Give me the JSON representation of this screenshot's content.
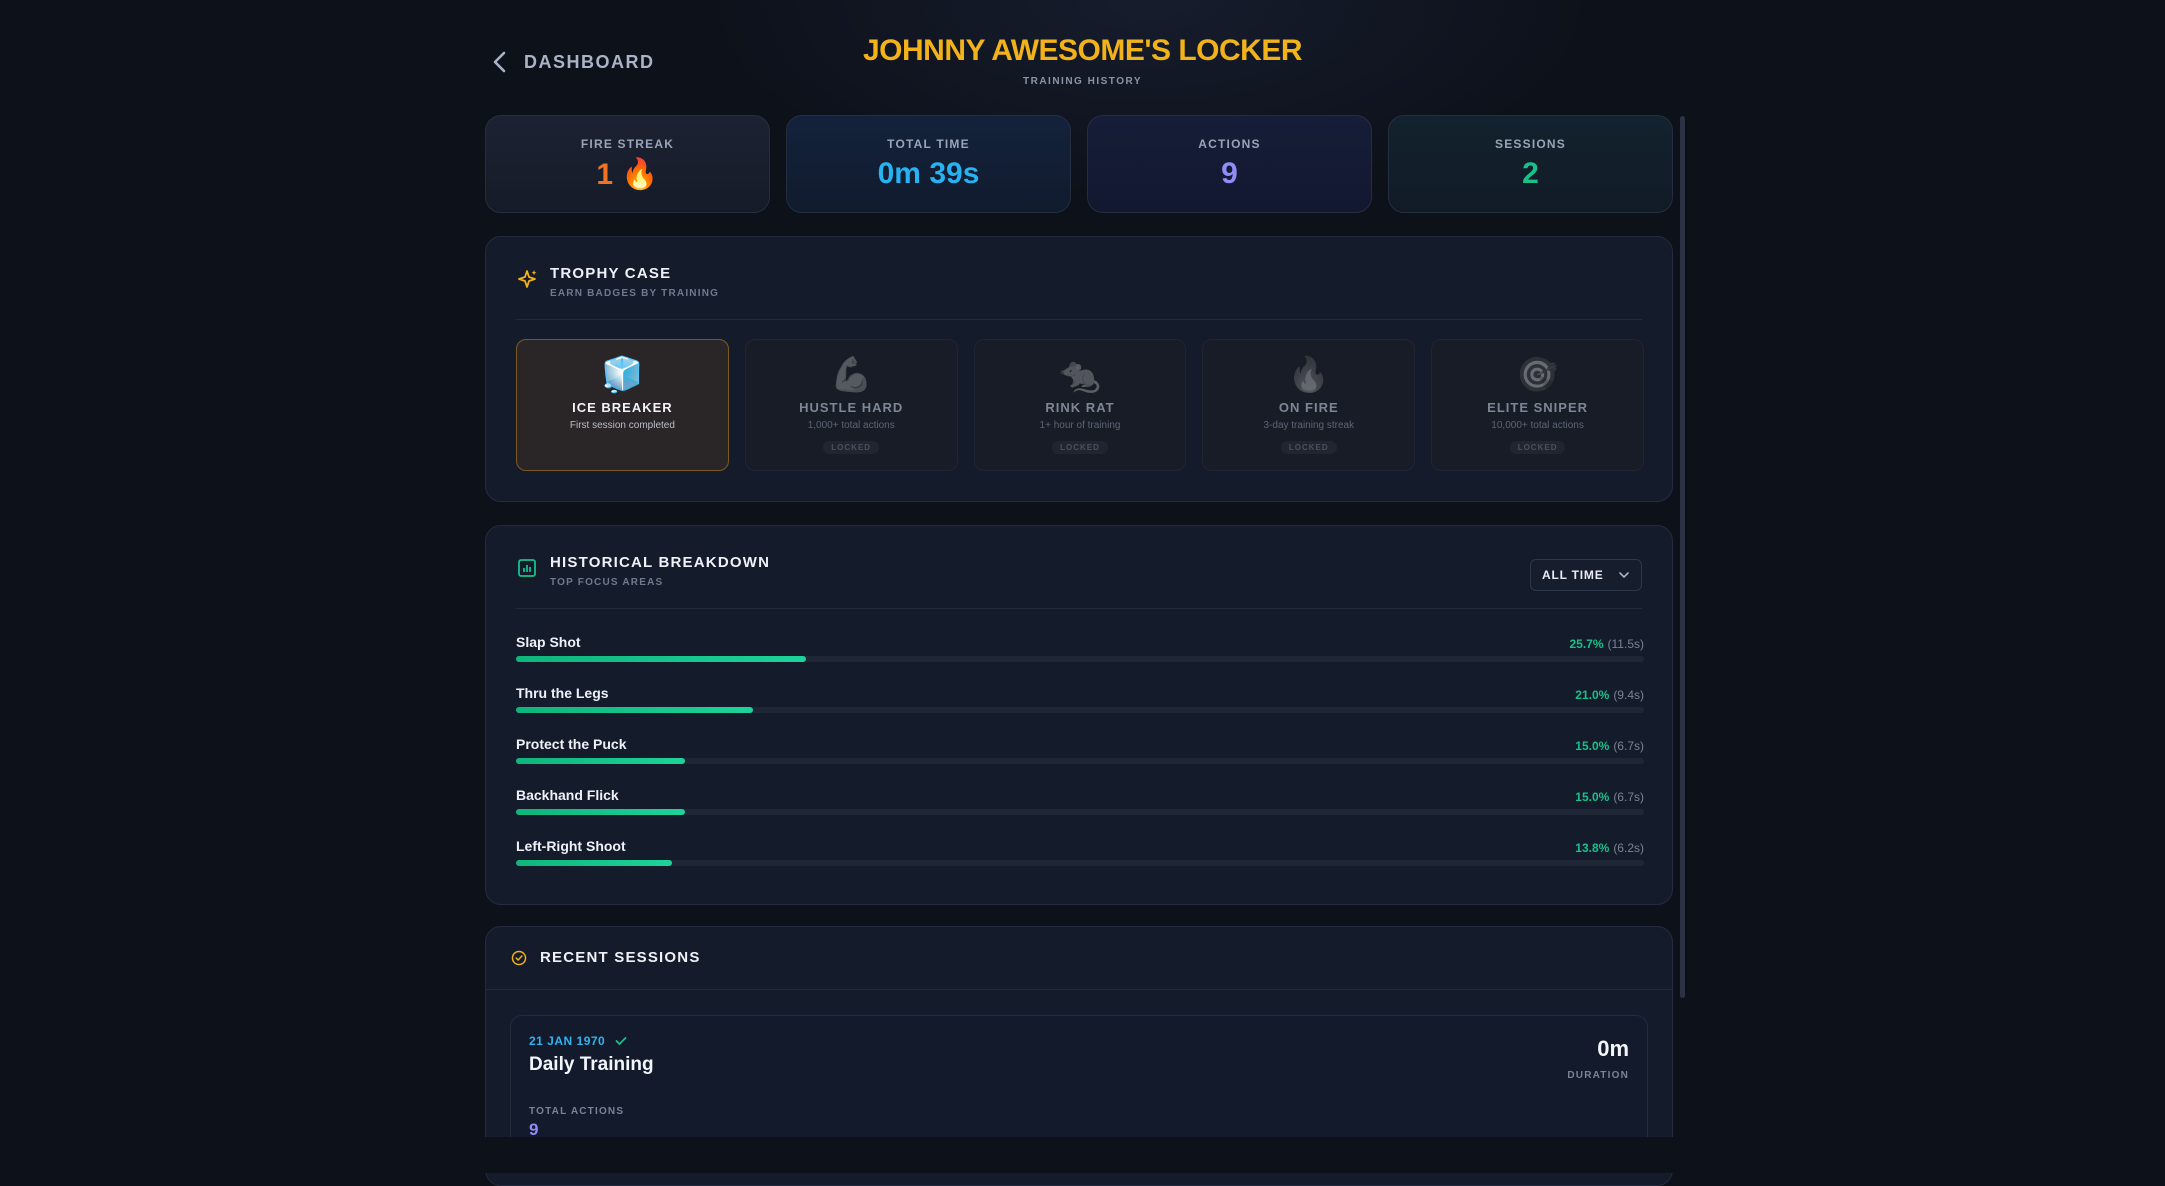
{
  "header": {
    "back_label": "DASHBOARD",
    "title": "JOHNNY AWESOME'S LOCKER",
    "subtitle": "TRAINING HISTORY"
  },
  "stats": [
    {
      "label": "FIRE STREAK",
      "value": "1 🔥",
      "color": "#f07424"
    },
    {
      "label": "TOTAL TIME",
      "value": "0m 39s",
      "color": "#27b2f2"
    },
    {
      "label": "ACTIONS",
      "value": "9",
      "color": "#8f8cf7"
    },
    {
      "label": "SESSIONS",
      "value": "2",
      "color": "#19c08a"
    }
  ],
  "trophy_case": {
    "title": "TROPHY CASE",
    "subtitle": "EARN BADGES BY TRAINING",
    "icon": "sparkles-icon",
    "badges": [
      {
        "emoji": "🧊",
        "name": "ICE BREAKER",
        "desc": "First session completed",
        "unlocked": true
      },
      {
        "emoji": "💪",
        "name": "HUSTLE HARD",
        "desc": "1,000+ total actions",
        "status": "LOCKED"
      },
      {
        "emoji": "🐀",
        "name": "RINK RAT",
        "desc": "1+ hour of training",
        "status": "LOCKED"
      },
      {
        "emoji": "🔥",
        "name": "ON FIRE",
        "desc": "3-day training streak",
        "status": "LOCKED"
      },
      {
        "emoji": "🎯",
        "name": "ELITE SNIPER",
        "desc": "10,000+ total actions",
        "status": "LOCKED"
      }
    ]
  },
  "breakdown": {
    "title": "HISTORICAL BREAKDOWN",
    "subtitle": "TOP FOCUS AREAS",
    "icon": "bar-chart-icon",
    "filter": "ALL TIME",
    "items": [
      {
        "name": "Slap Shot",
        "pct": "25.7%",
        "secs": "(11.5s)",
        "fraction": 0.257
      },
      {
        "name": "Thru the Legs",
        "pct": "21.0%",
        "secs": "(9.4s)",
        "fraction": 0.21
      },
      {
        "name": "Protect the Puck",
        "pct": "15.0%",
        "secs": "(6.7s)",
        "fraction": 0.15
      },
      {
        "name": "Backhand Flick",
        "pct": "15.0%",
        "secs": "(6.7s)",
        "fraction": 0.15
      },
      {
        "name": "Left-Right Shoot",
        "pct": "13.8%",
        "secs": "(6.2s)",
        "fraction": 0.138
      }
    ]
  },
  "recent": {
    "title": "RECENT SESSIONS",
    "icon": "check-circle-icon",
    "session": {
      "date": "21 JAN 1970",
      "name": "Daily Training",
      "duration": "0m",
      "duration_label": "DURATION",
      "actions_label": "TOTAL ACTIONS",
      "actions": "9"
    }
  }
}
